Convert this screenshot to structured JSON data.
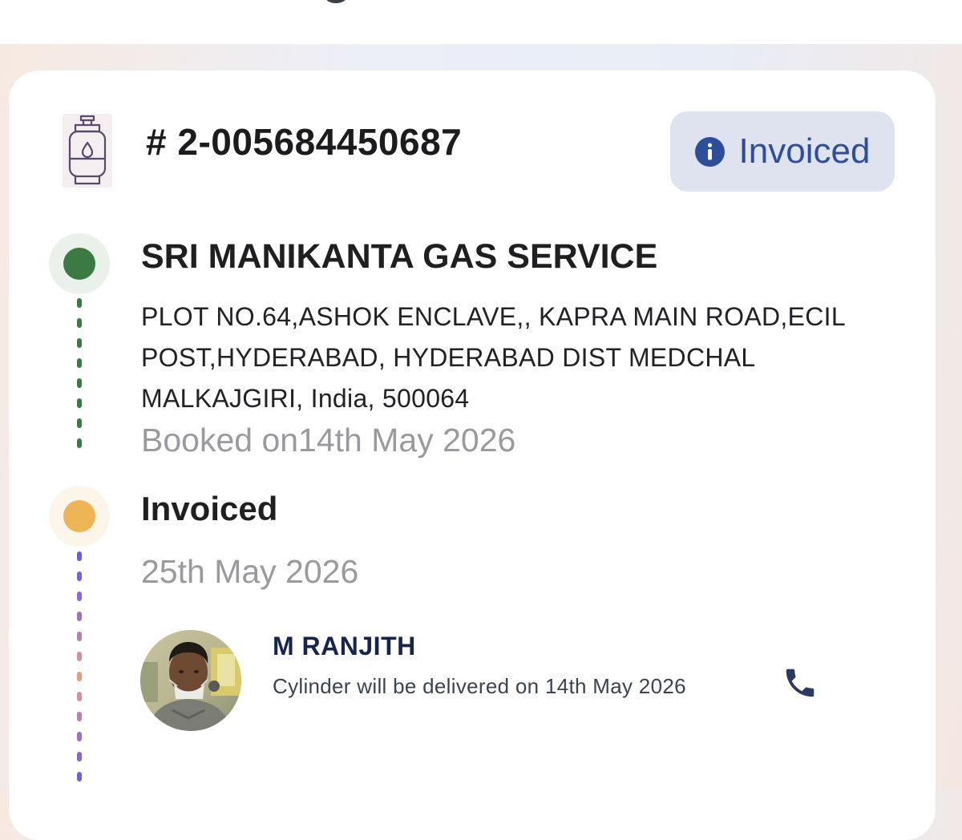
{
  "order": {
    "id": "# 2-005684450687",
    "status": "Invoiced"
  },
  "timeline": [
    {
      "title": "SRI MANIKANTA GAS SERVICE",
      "address": "PLOT NO.64,ASHOK ENCLAVE,, KAPRA MAIN ROAD,ECIL POST,HYDERABAD, HYDERABAD DIST MEDCHAL MALKAJGIRI, India, 500064",
      "date": "Booked on14th May 2026"
    },
    {
      "title": "Invoiced",
      "date": "25th May 2026"
    }
  ],
  "delivery": {
    "person_name": "M RANJITH",
    "message": "Cylinder will be delivered on 14th May 2026"
  },
  "icons": {
    "product": "gas-cylinder-icon",
    "status": "info-icon",
    "call": "phone-icon"
  },
  "colors": {
    "badge_bg": "#dee3ef",
    "badge_text": "#2f4e9a",
    "step1_dot": "#3c7a44",
    "step2_dot": "#eeb557",
    "name_text": "#17254d"
  }
}
